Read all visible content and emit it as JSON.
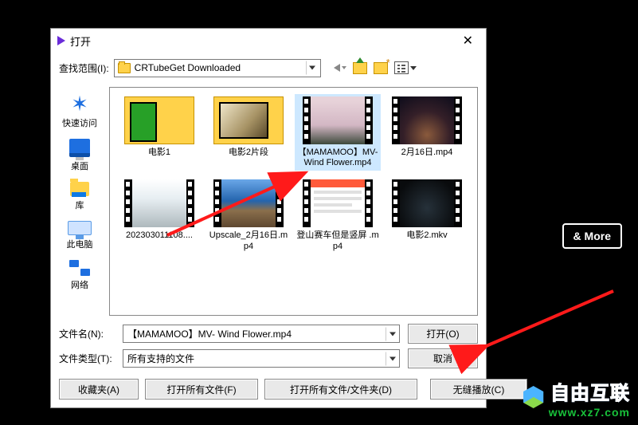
{
  "window": {
    "title": "打开"
  },
  "lookin": {
    "label": "查找范围(I):",
    "value": "CRTubeGet Downloaded"
  },
  "places": {
    "quick": "快速访问",
    "desktop": "桌面",
    "library": "库",
    "thispc": "此电脑",
    "network": "网络"
  },
  "files": [
    {
      "name": "电影1",
      "type": "folder",
      "variant": "folder"
    },
    {
      "name": "电影2片段",
      "type": "folder",
      "variant": "folder2"
    },
    {
      "name": "【MAMAMOO】MV- Wind Flower.mp4",
      "type": "video",
      "variant": "pink",
      "selected": true
    },
    {
      "name": "2月16日.mp4",
      "type": "video",
      "variant": "stars"
    },
    {
      "name": "202303011108....",
      "type": "video",
      "variant": "snow"
    },
    {
      "name": "Upscale_2月16日.mp4",
      "type": "video",
      "variant": "crowd"
    },
    {
      "name": "登山赛车但是竖屏   .mp4",
      "type": "video",
      "variant": "app"
    },
    {
      "name": "电影2.mkv",
      "type": "video",
      "variant": "dark"
    }
  ],
  "fields": {
    "filename_label": "文件名(N):",
    "filename_value": "【MAMAMOO】MV- Wind Flower.mp4",
    "filetype_label": "文件类型(T):",
    "filetype_value": "所有支持的文件"
  },
  "buttons": {
    "open": "打开(O)",
    "cancel": "取消",
    "favorites": "收藏夹(A)",
    "open_all": "打开所有文件(F)",
    "open_all_folders": "打开所有文件/文件夹(D)",
    "seamless": "无缝播放(C)"
  },
  "background": {
    "more_btn": "& More"
  },
  "watermark": {
    "line1": "自由互联",
    "line2": "www.xz7.com"
  }
}
